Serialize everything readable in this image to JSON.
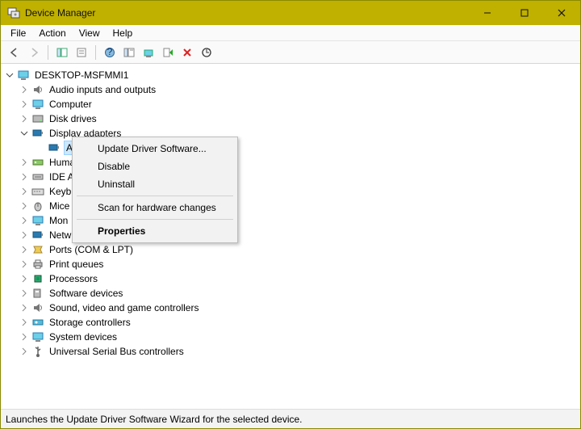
{
  "window": {
    "title": "Device Manager"
  },
  "menu": {
    "file": "File",
    "action": "Action",
    "view": "View",
    "help": "Help"
  },
  "tree": {
    "root": "DESKTOP-MSFMMI1",
    "items": [
      "Audio inputs and outputs",
      "Computer",
      "Disk drives",
      "Display adapters",
      "Human",
      "IDE A",
      "Keyb",
      "Mice",
      "Mon",
      "Netw",
      "Ports (COM & LPT)",
      "Print queues",
      "Processors",
      "Software devices",
      "Sound, video and game controllers",
      "Storage controllers",
      "System devices",
      "Universal Serial Bus controllers"
    ],
    "selected_partial": "A"
  },
  "context": {
    "update": "Update Driver Software...",
    "disable": "Disable",
    "uninstall": "Uninstall",
    "scan": "Scan for hardware changes",
    "properties": "Properties"
  },
  "status": {
    "text": "Launches the Update Driver Software Wizard for the selected device."
  }
}
